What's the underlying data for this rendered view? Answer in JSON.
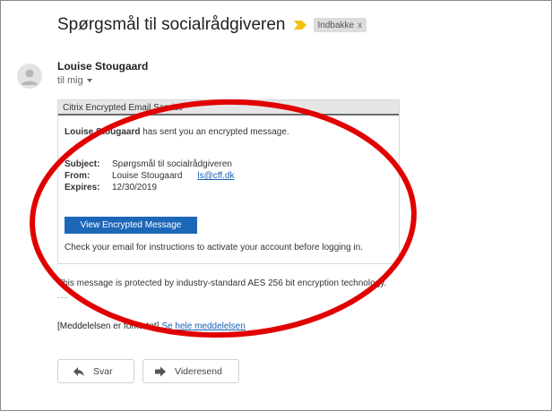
{
  "email": {
    "subject": "Spørgsmål til socialrådgiveren",
    "label_chip": "Indbakke",
    "label_close": "x",
    "sender_name": "Louise Stougaard",
    "recipient": "til mig"
  },
  "card": {
    "header": "Citrix Encrypted Email Service",
    "intro_name": "Louise Stougaard",
    "intro_text": " has sent you an encrypted message.",
    "subject_label": "Subject:",
    "subject_value": "Spørgsmål til socialrådgiveren",
    "from_label": "From:",
    "from_name": "Louise Stougaard",
    "from_email": "ls@cff.dk",
    "expires_label": "Expires:",
    "expires_value": "12/30/2019",
    "button_label": "View Encrypted Message",
    "note": "Check your email for instructions to activate your account before logging in."
  },
  "body": {
    "protection_note": "This message is protected by industry-standard AES 256 bit encryption technology.",
    "dashes": "---",
    "truncated_text": "[Meddelelsen er forkortet]",
    "full_message_link": "Se hele meddelelsen"
  },
  "actions": {
    "reply_label": "Svar",
    "forward_label": "Videresend"
  },
  "colors": {
    "button_blue": "#1d67b8",
    "link_blue": "#1a5fb4",
    "importance_yellow": "#f4c20d",
    "annotation_red": "#e00000"
  },
  "icons": {
    "importance": "importance-marker-icon",
    "avatar": "person-avatar-icon",
    "reply": "reply-arrow-icon",
    "forward": "forward-arrow-icon"
  }
}
